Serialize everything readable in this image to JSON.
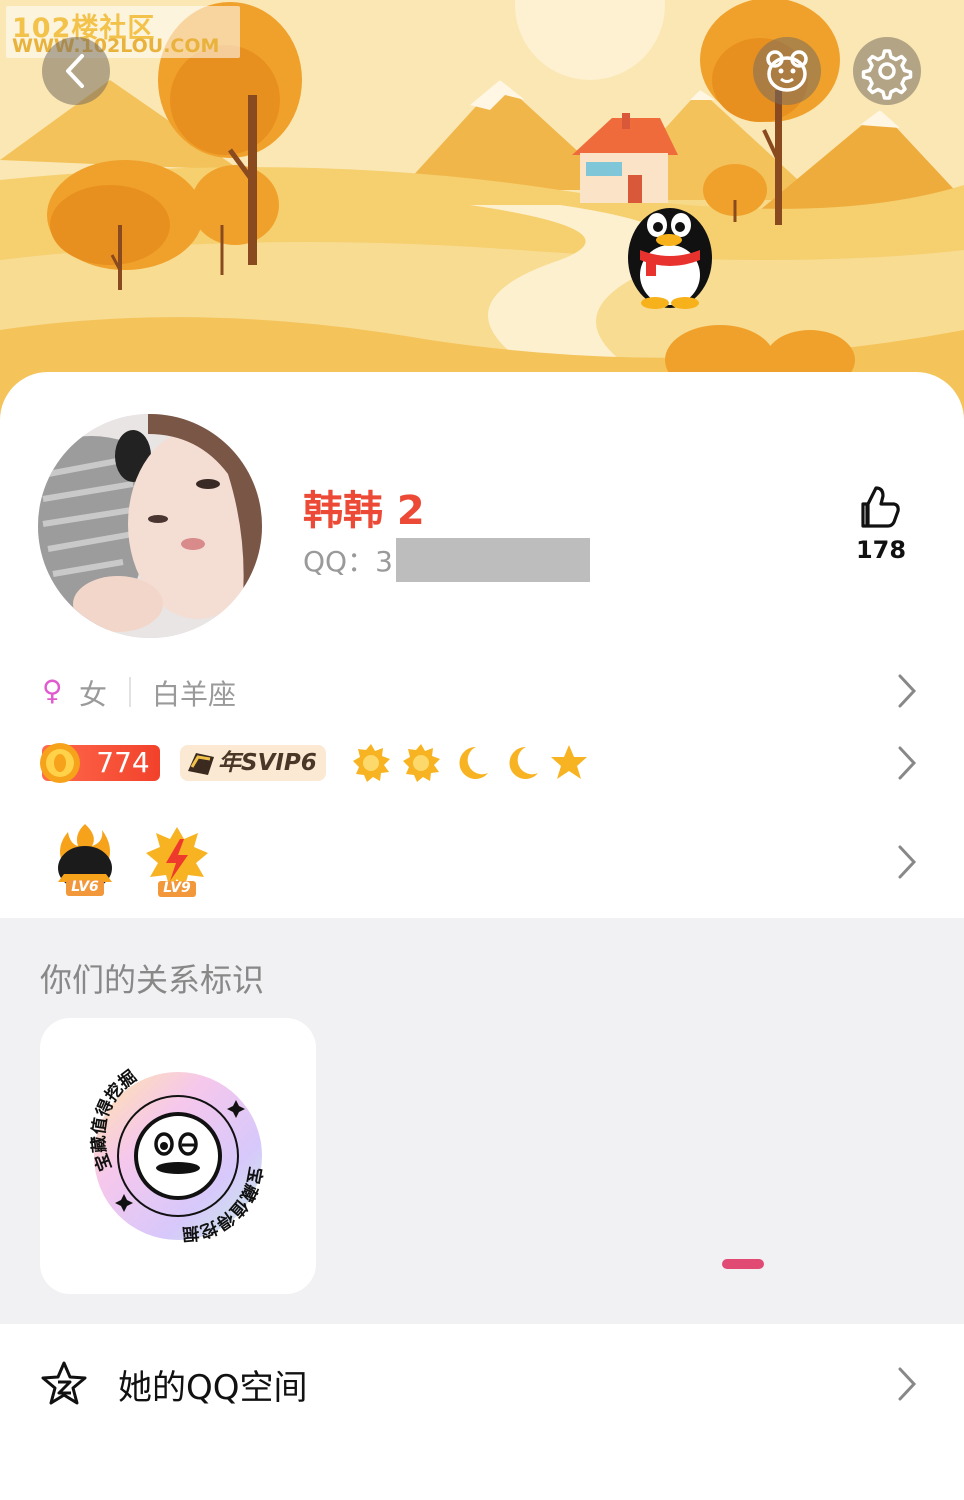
{
  "watermark": {
    "title": "102楼社区",
    "url": "WWW.102LOU.COM"
  },
  "header": {
    "back_icon": "chevron-left-icon",
    "profile_decor_icon": "bear-face-icon",
    "settings_icon": "gear-icon"
  },
  "profile": {
    "nickname": "韩韩 2",
    "qq_label": "QQ：3",
    "likes": "178",
    "gender_symbol": "♀",
    "gender": "女",
    "zodiac": "白羊座",
    "level_value": "774",
    "svip_label": "年SVIP6",
    "level_icons": [
      "sun-icon",
      "sun-icon",
      "moon-icon",
      "moon-icon",
      "star-icon"
    ],
    "badges": [
      "LV6",
      "LV9"
    ]
  },
  "relation": {
    "title": "你们的关系标识",
    "badge_text": "宝藏值得挖掘"
  },
  "qzone": {
    "label": "她的QQ空间"
  },
  "colors": {
    "accent_red": "#ec4a36",
    "gold": "#f5b82e",
    "gray_bg": "#f1f1f3",
    "indicator_pink": "#e14a72"
  }
}
